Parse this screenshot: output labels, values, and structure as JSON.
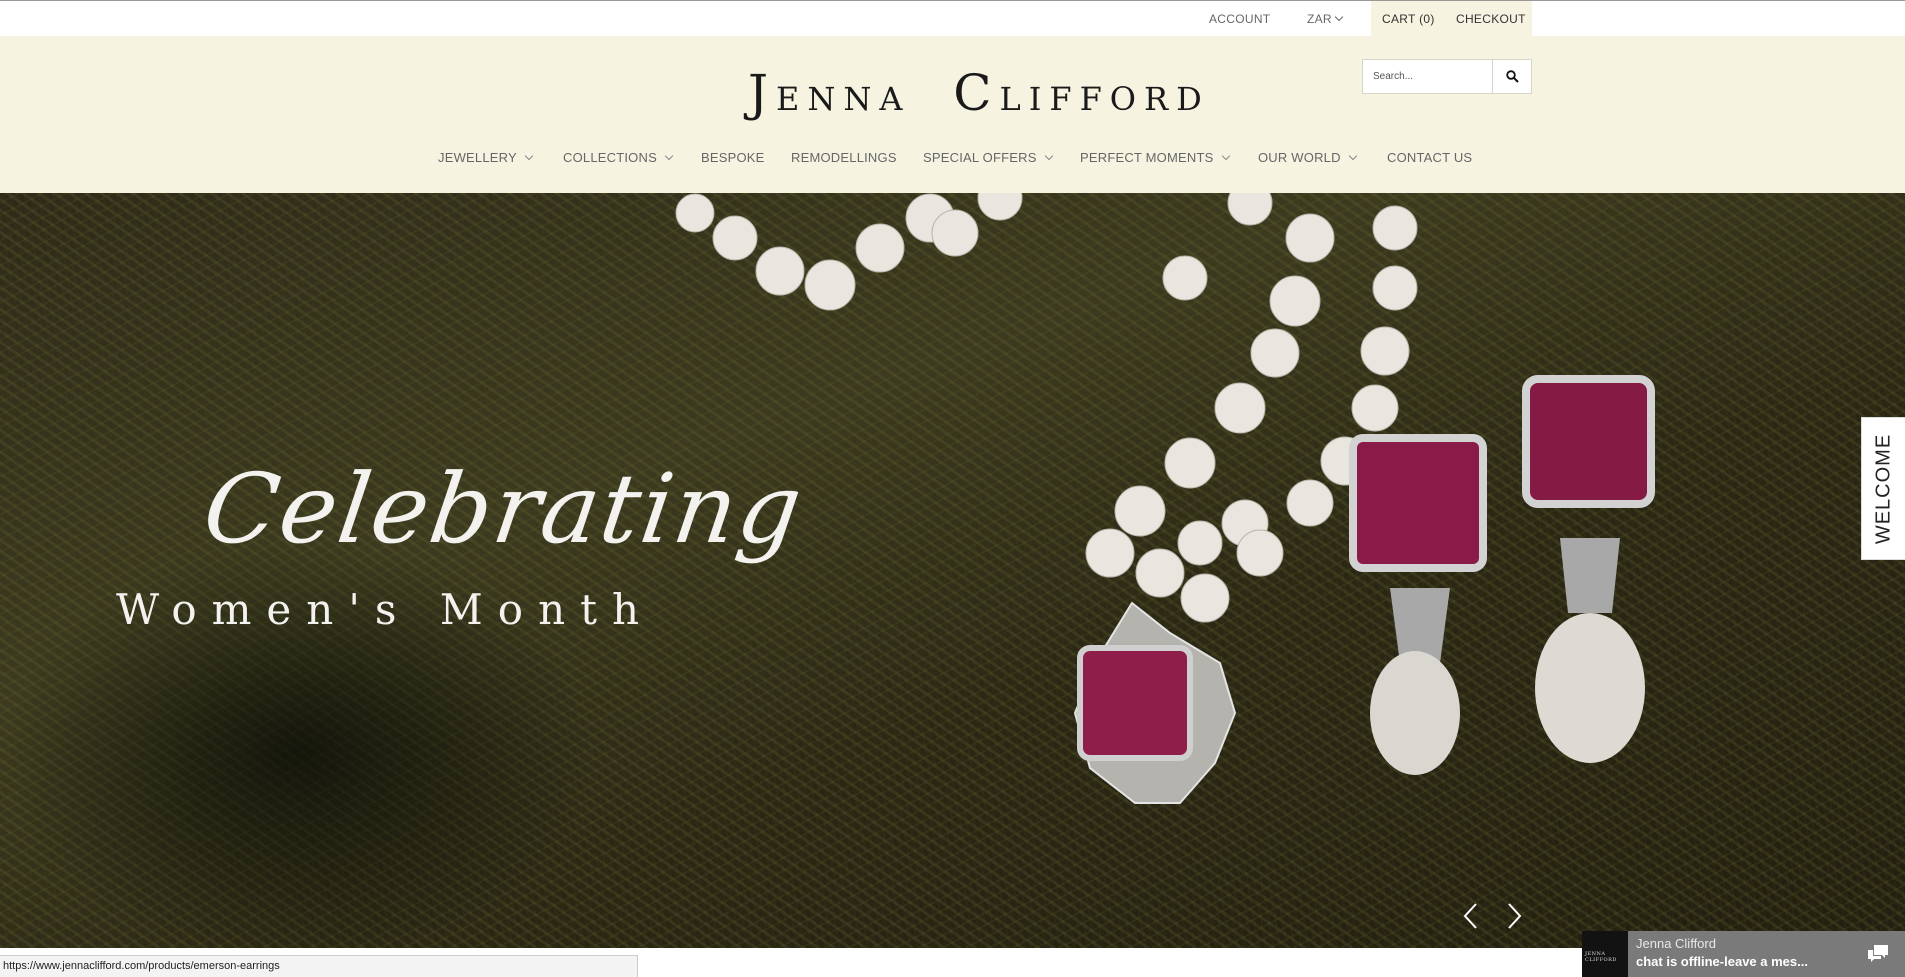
{
  "topbar": {
    "account": "ACCOUNT",
    "currency": "ZAR",
    "cart": "CART (0)",
    "checkout": "CHECKOUT"
  },
  "header": {
    "logo_text": "Jenna Clifford",
    "search_placeholder": "Search..."
  },
  "nav": {
    "items": [
      {
        "label": "JEWELLERY",
        "has_dropdown": true
      },
      {
        "label": "COLLECTIONS",
        "has_dropdown": true
      },
      {
        "label": "BESPOKE",
        "has_dropdown": false
      },
      {
        "label": "REMODELLINGS",
        "has_dropdown": false
      },
      {
        "label": "SPECIAL OFFERS",
        "has_dropdown": true
      },
      {
        "label": "PERFECT MOMENTS",
        "has_dropdown": true
      },
      {
        "label": "OUR WORLD",
        "has_dropdown": true
      },
      {
        "label": "CONTACT US",
        "has_dropdown": false
      }
    ]
  },
  "hero": {
    "script_text": "Celebrating",
    "title": "Women's Month",
    "prev_icon": "chevron-left-icon",
    "next_icon": "chevron-right-icon"
  },
  "welcome_tab": {
    "label": "WELCOME"
  },
  "status_bar": {
    "url": "https://www.jennaclifford.com/products/emerson-earrings"
  },
  "chat": {
    "name": "Jenna Clifford",
    "message": "chat is offline-leave a mes...",
    "thumb_text": "JENNA CLIFFORD",
    "icon": "chat-bubbles-icon"
  },
  "colors": {
    "header_bg": "#f6f4e1",
    "text_muted": "#666666",
    "chat_bg": "#7a7a7a"
  }
}
